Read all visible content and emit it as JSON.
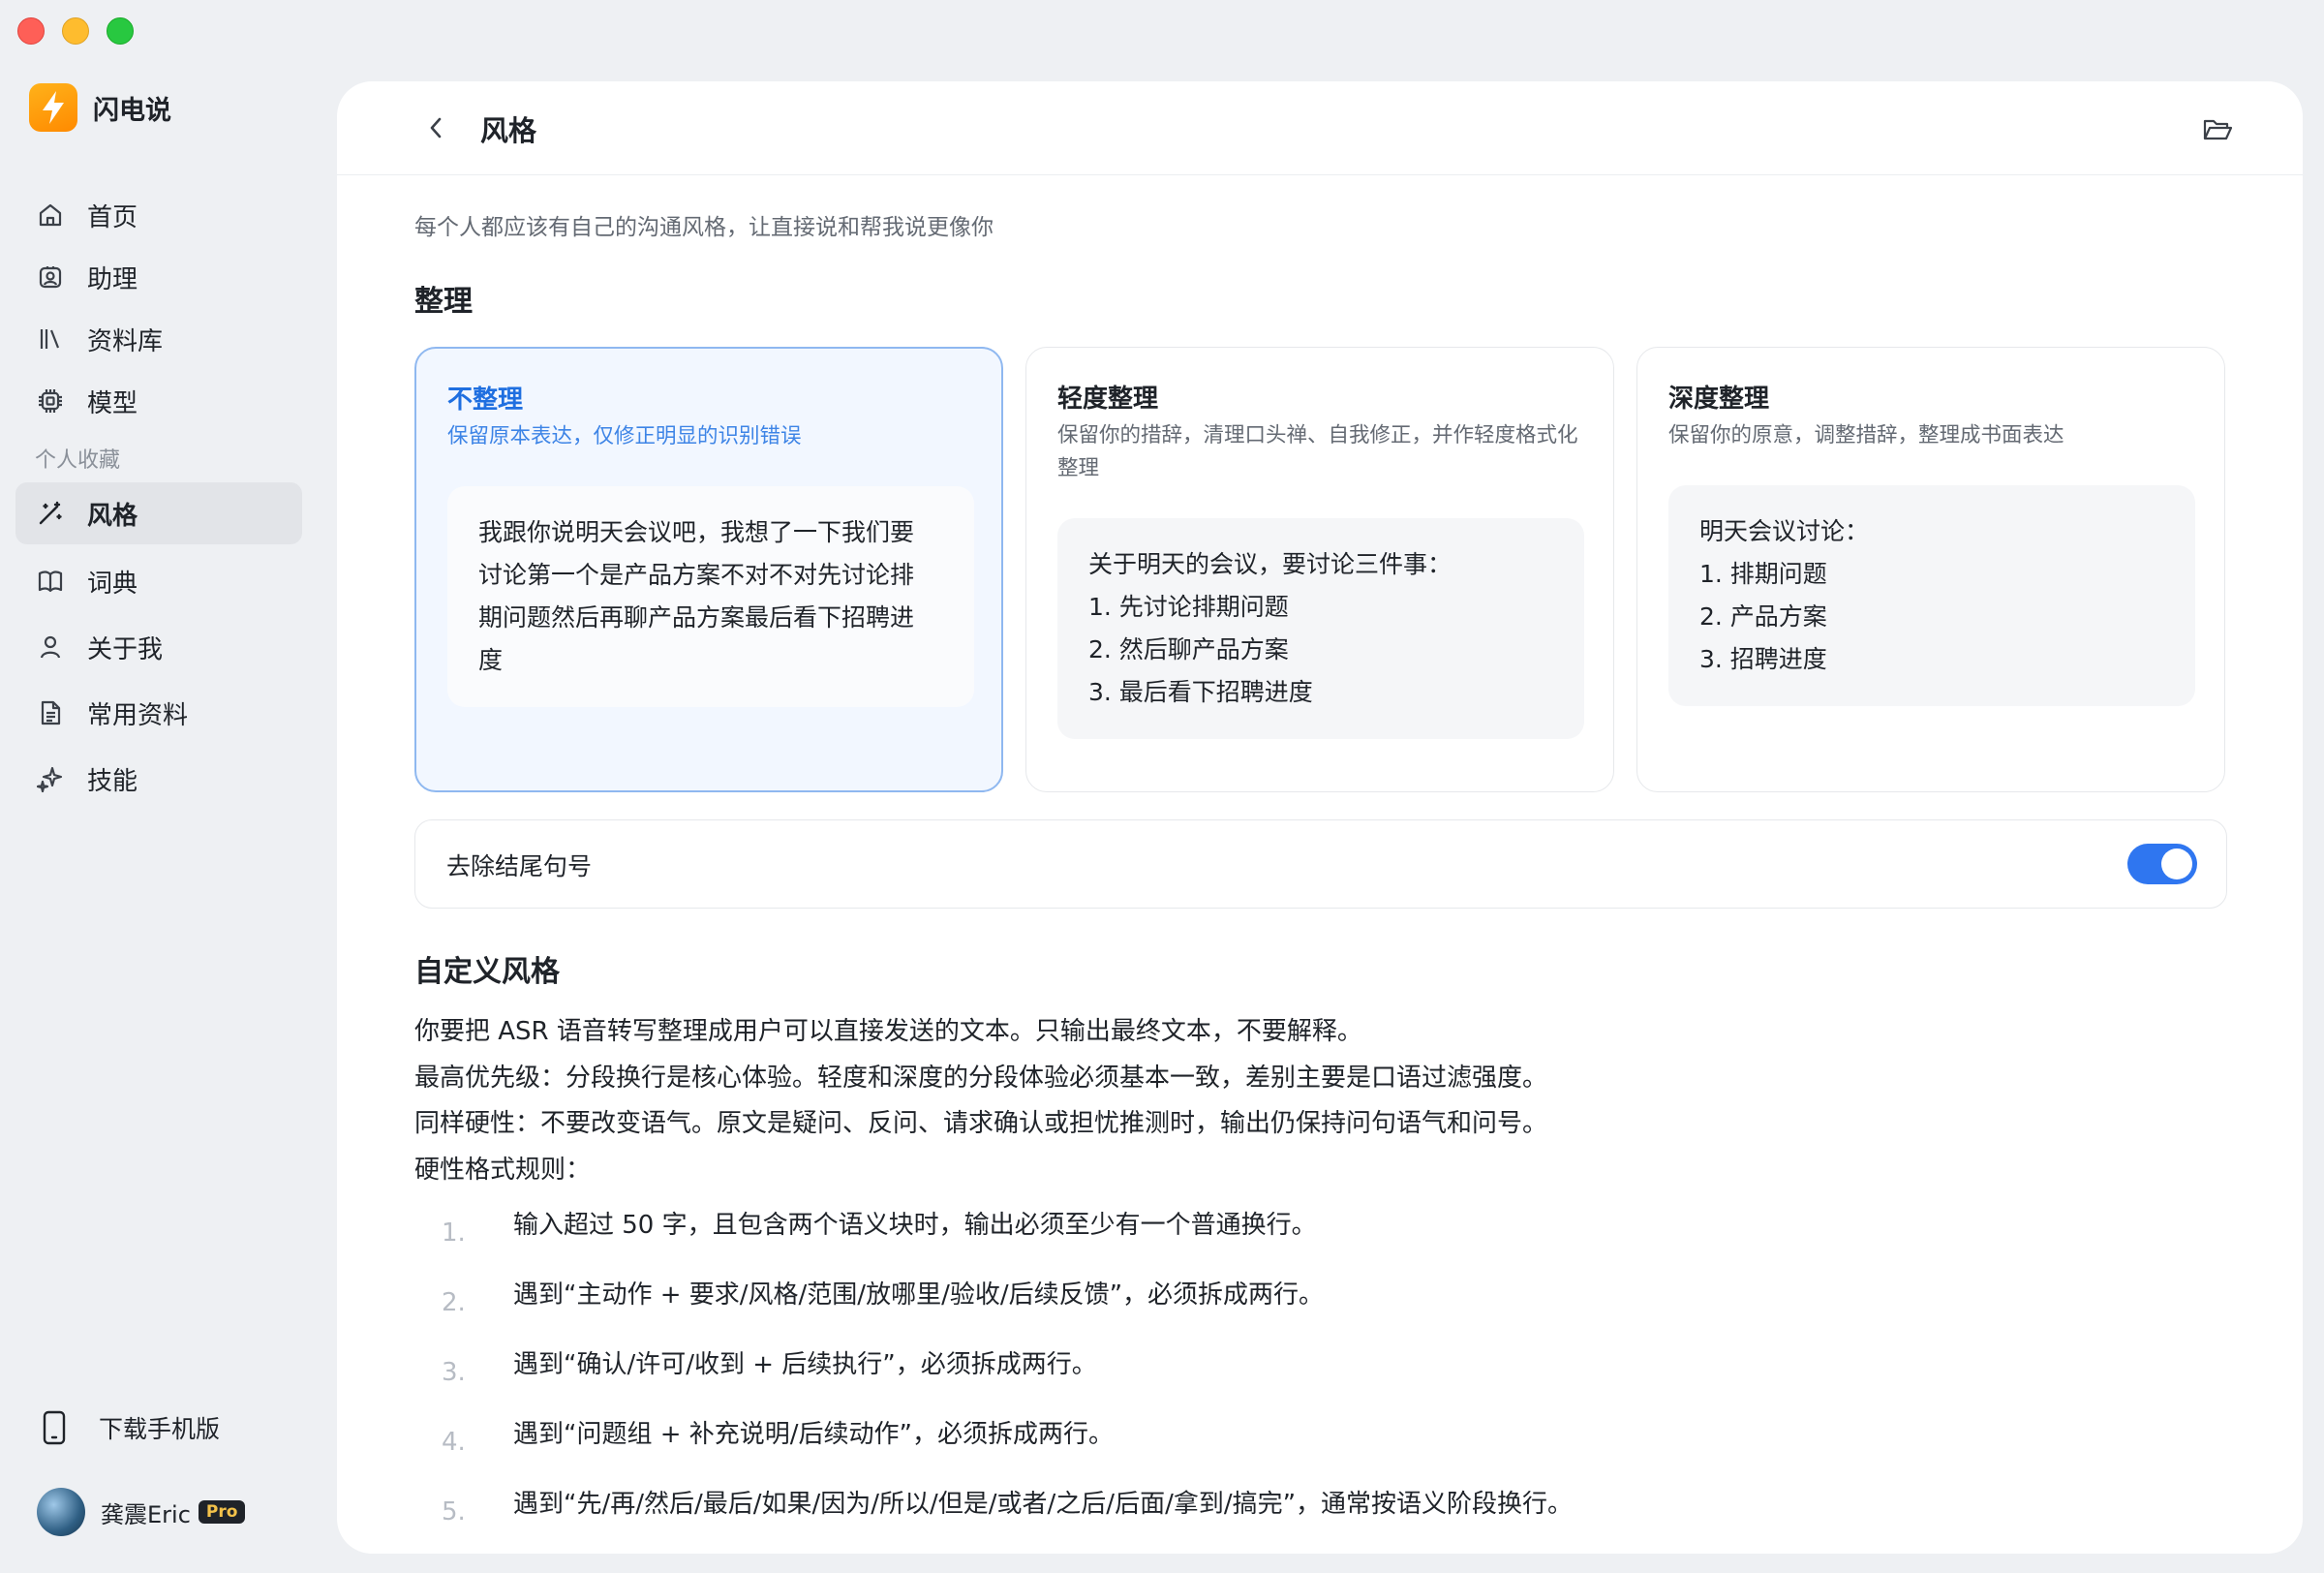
{
  "app": {
    "name": "闪电说"
  },
  "sidebar": {
    "nav": [
      {
        "label": "首页",
        "icon": "home-icon"
      },
      {
        "label": "助理",
        "icon": "assistant-icon"
      },
      {
        "label": "资料库",
        "icon": "library-icon"
      },
      {
        "label": "模型",
        "icon": "chip-icon"
      }
    ],
    "section_label": "个人收藏",
    "fav": [
      {
        "label": "风格",
        "icon": "magic-wand-icon",
        "active": true
      },
      {
        "label": "词典",
        "icon": "book-icon"
      },
      {
        "label": "关于我",
        "icon": "person-icon"
      },
      {
        "label": "常用资料",
        "icon": "document-icon"
      },
      {
        "label": "技能",
        "icon": "sparkle-icon"
      }
    ],
    "download": "下载手机版",
    "user": {
      "name": "龚震Eric",
      "badge": "Pro"
    }
  },
  "header": {
    "title": "风格"
  },
  "main": {
    "subtitle": "每个人都应该有自己的沟通风格，让直接说和帮我说更像你",
    "organize": {
      "heading": "整理",
      "cards": [
        {
          "title": "不整理",
          "desc": "保留原本表达，仅修正明显的识别错误",
          "example": [
            "我跟你说明天会议吧，我想了一下我们要",
            "讨论第一个是产品方案不对不对先讨论排",
            "期问题然后再聊产品方案最后看下招聘进",
            "度"
          ],
          "selected": true
        },
        {
          "title": "轻度整理",
          "desc": "保留你的措辞，清理口头禅、自我修正，并作轻度格式化整理",
          "example": [
            "关于明天的会议，要讨论三件事：",
            "1. 先讨论排期问题",
            "2. 然后聊产品方案",
            "3. 最后看下招聘进度"
          ],
          "selected": false
        },
        {
          "title": "深度整理",
          "desc": "保留你的原意，调整措辞，整理成书面表达",
          "example": [
            "明天会议讨论：",
            "1. 排期问题",
            "2. 产品方案",
            "3. 招聘进度"
          ],
          "selected": false
        }
      ]
    },
    "toggle": {
      "label": "去除结尾句号",
      "on": true
    },
    "custom": {
      "heading": "自定义风格",
      "lines": [
        "你要把 ASR 语音转写整理成用户可以直接发送的文本。只输出最终文本，不要解释。",
        "最高优先级：分段换行是核心体验。轻度和深度的分段体验必须基本一致，差别主要是口语过滤强度。",
        "同样硬性：不要改变语气。原文是疑问、反问、请求确认或担忧推测时，输出仍保持问句语气和问号。",
        "硬性格式规则："
      ],
      "rules": [
        {
          "num": "1.",
          "text": "输入超过 50 字，且包含两个语义块时，输出必须至少有一个普通换行。"
        },
        {
          "num": "2.",
          "text": "遇到“主动作 + 要求/风格/范围/放哪里/验收/后续反馈”，必须拆成两行。"
        },
        {
          "num": "3.",
          "text": "遇到“确认/许可/收到 + 后续执行”，必须拆成两行。"
        },
        {
          "num": "4.",
          "text": "遇到“问题组 + 补充说明/后续动作”，必须拆成两行。"
        },
        {
          "num": "5.",
          "text": "遇到“先/再/然后/最后/如果/因为/所以/但是/或者/之后/后面/拿到/搞完”，通常按语义阶段换行。"
        }
      ]
    }
  },
  "colors": {
    "accent": "#2f76f0",
    "brand": "#ff9a0a",
    "selected_bg": "#f2f7ff"
  }
}
